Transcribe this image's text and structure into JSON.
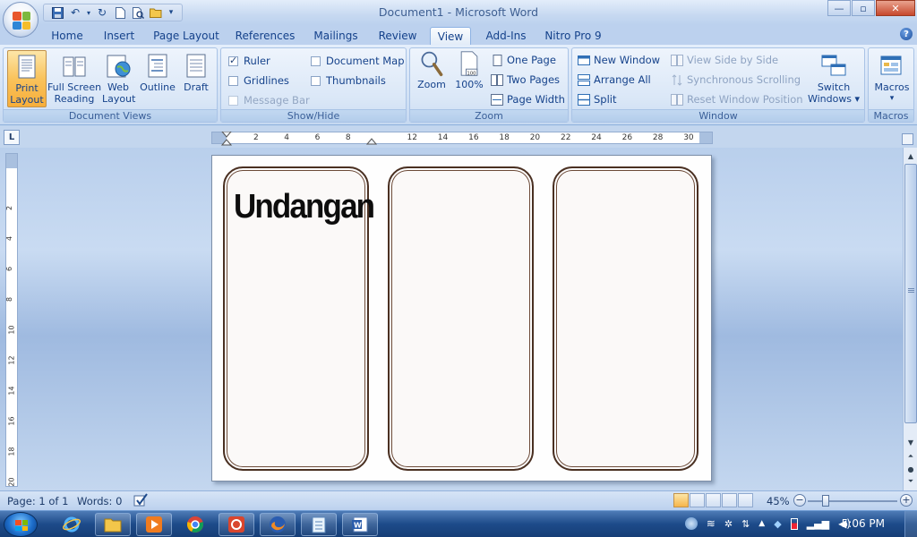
{
  "window": {
    "title": "Document1 - Microsoft Word",
    "controls": {
      "minimize": "—",
      "maximize": "▫",
      "close": "✕"
    }
  },
  "qat": {
    "customize": "▾"
  },
  "tabs": [
    {
      "label": "Home",
      "active": false
    },
    {
      "label": "Insert",
      "active": false
    },
    {
      "label": "Page Layout",
      "active": false
    },
    {
      "label": "References",
      "active": false
    },
    {
      "label": "Mailings",
      "active": false
    },
    {
      "label": "Review",
      "active": false
    },
    {
      "label": "View",
      "active": true
    },
    {
      "label": "Add-Ins",
      "active": false
    },
    {
      "label": "Nitro Pro 9",
      "active": false
    }
  ],
  "help": "?",
  "ribbon": {
    "document_views": {
      "label": "Document Views",
      "print_layout": "Print Layout",
      "print_layout_l1": "Print",
      "print_layout_l2": "Layout",
      "full_screen_l1": "Full Screen",
      "full_screen_l2": "Reading",
      "web_layout_l1": "Web",
      "web_layout_l2": "Layout",
      "outline": "Outline",
      "draft": "Draft"
    },
    "show_hide": {
      "label": "Show/Hide",
      "ruler": {
        "label": "Ruler",
        "checked": true
      },
      "gridlines": {
        "label": "Gridlines",
        "checked": false
      },
      "message_bar": {
        "label": "Message Bar",
        "checked": false,
        "disabled": true
      },
      "document_map": {
        "label": "Document Map",
        "checked": false
      },
      "thumbnails": {
        "label": "Thumbnails",
        "checked": false
      }
    },
    "zoom": {
      "label": "Zoom",
      "zoom": "Zoom",
      "hundred": "100%",
      "one_page": "One Page",
      "two_pages": "Two Pages",
      "page_width": "Page Width"
    },
    "window": {
      "label": "Window",
      "new_window": "New Window",
      "arrange_all": "Arrange All",
      "split": "Split",
      "view_side_by_side": "View Side by Side",
      "synchronous_scrolling": "Synchronous Scrolling",
      "reset_window_position": "Reset Window Position",
      "switch_windows_l1": "Switch",
      "switch_windows_l2": "Windows ▾"
    },
    "macros": {
      "label": "Macros",
      "button": "Macros",
      "arrow": "▾"
    }
  },
  "ruler": {
    "corner": "L",
    "numbers": [
      "2",
      "4",
      "6",
      "8",
      "",
      "12",
      "14",
      "16",
      "18",
      "20",
      "22",
      "24",
      "26",
      "28",
      "30"
    ]
  },
  "vruler_numbers": [
    "2",
    "4",
    "6",
    "8",
    "10",
    "12",
    "14",
    "16",
    "18",
    "20"
  ],
  "document": {
    "panels": [
      {
        "title": "Undangan"
      },
      {
        "title": ""
      },
      {
        "title": ""
      }
    ]
  },
  "status": {
    "page": "Page: 1 of 1",
    "words": "Words: 0",
    "zoom_percent": "45%",
    "zoom_minus": "−",
    "zoom_plus": "+"
  },
  "taskbar": {
    "clock": "5:06 PM",
    "tray_arrow": "▲"
  },
  "colors": {
    "ribbon_bg": "#d6e4f6",
    "active_button": "#f9c35c",
    "panel_border": "#4a3022",
    "taskbar": "#1d4b8a"
  }
}
